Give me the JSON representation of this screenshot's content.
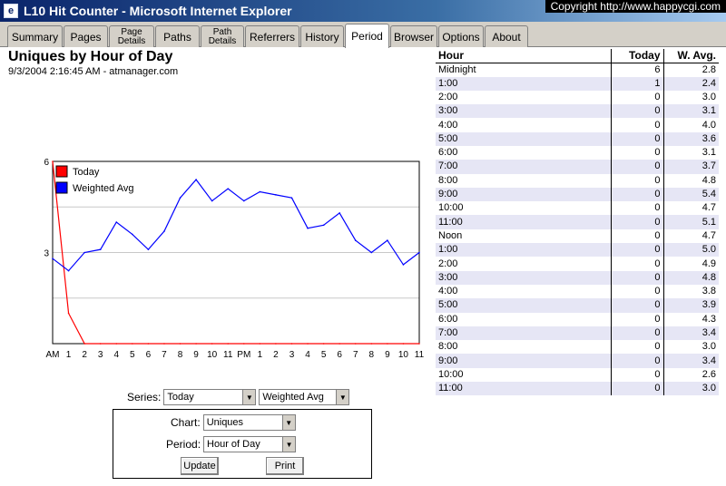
{
  "window": {
    "title": "L10 Hit Counter - Microsoft Internet Explorer",
    "copyright": "Copyright   http://www.happycgi.com"
  },
  "tabs": [
    {
      "label": "Summary"
    },
    {
      "label": "Pages"
    },
    {
      "label": "Page\nDetails"
    },
    {
      "label": "Paths"
    },
    {
      "label": "Path\nDetails"
    },
    {
      "label": "Referrers"
    },
    {
      "label": "History"
    },
    {
      "label": "Period",
      "active": true
    },
    {
      "label": "Browser"
    },
    {
      "label": "Options"
    },
    {
      "label": "About"
    }
  ],
  "heading": {
    "title": "Uniques by Hour of Day",
    "subtitle": "9/3/2004 2:16:45 AM - atmanager.com"
  },
  "chart_data": {
    "type": "line",
    "categories": [
      "AM",
      "1",
      "2",
      "3",
      "4",
      "5",
      "6",
      "7",
      "8",
      "9",
      "10",
      "11",
      "PM",
      "1",
      "2",
      "3",
      "4",
      "5",
      "6",
      "7",
      "8",
      "9",
      "10",
      "11"
    ],
    "series": [
      {
        "name": "Today",
        "color": "#ff0000",
        "values": [
          6,
          1,
          0,
          0,
          0,
          0,
          0,
          0,
          0,
          0,
          0,
          0,
          0,
          0,
          0,
          0,
          0,
          0,
          0,
          0,
          0,
          0,
          0,
          0
        ]
      },
      {
        "name": "Weighted Avg",
        "color": "#0000ff",
        "values": [
          2.8,
          2.4,
          3.0,
          3.1,
          4.0,
          3.6,
          3.1,
          3.7,
          4.8,
          5.4,
          4.7,
          5.1,
          4.7,
          5.0,
          4.9,
          4.8,
          3.8,
          3.9,
          4.3,
          3.4,
          3.0,
          3.4,
          2.6,
          3.0
        ]
      }
    ],
    "y_ticks": [
      "6",
      "3"
    ],
    "ylim": [
      0,
      6
    ],
    "legend": "top-left",
    "grid": true
  },
  "controls": {
    "series_label": "Series:",
    "series1": "Today",
    "series2": "Weighted Avg",
    "chart_label": "Chart:",
    "chart_value": "Uniques",
    "period_label": "Period:",
    "period_value": "Hour of Day",
    "update": "Update",
    "print": "Print"
  },
  "table": {
    "headers": {
      "hour": "Hour",
      "today": "Today",
      "avg": "W. Avg."
    },
    "rows": [
      {
        "hour": "Midnight",
        "today": "6",
        "avg": "2.8"
      },
      {
        "hour": "1:00",
        "today": "1",
        "avg": "2.4"
      },
      {
        "hour": "2:00",
        "today": "0",
        "avg": "3.0"
      },
      {
        "hour": "3:00",
        "today": "0",
        "avg": "3.1"
      },
      {
        "hour": "4:00",
        "today": "0",
        "avg": "4.0"
      },
      {
        "hour": "5:00",
        "today": "0",
        "avg": "3.6"
      },
      {
        "hour": "6:00",
        "today": "0",
        "avg": "3.1"
      },
      {
        "hour": "7:00",
        "today": "0",
        "avg": "3.7"
      },
      {
        "hour": "8:00",
        "today": "0",
        "avg": "4.8"
      },
      {
        "hour": "9:00",
        "today": "0",
        "avg": "5.4"
      },
      {
        "hour": "10:00",
        "today": "0",
        "avg": "4.7"
      },
      {
        "hour": "11:00",
        "today": "0",
        "avg": "5.1"
      },
      {
        "hour": "Noon",
        "today": "0",
        "avg": "4.7"
      },
      {
        "hour": "1:00",
        "today": "0",
        "avg": "5.0"
      },
      {
        "hour": "2:00",
        "today": "0",
        "avg": "4.9"
      },
      {
        "hour": "3:00",
        "today": "0",
        "avg": "4.8"
      },
      {
        "hour": "4:00",
        "today": "0",
        "avg": "3.8"
      },
      {
        "hour": "5:00",
        "today": "0",
        "avg": "3.9"
      },
      {
        "hour": "6:00",
        "today": "0",
        "avg": "4.3"
      },
      {
        "hour": "7:00",
        "today": "0",
        "avg": "3.4"
      },
      {
        "hour": "8:00",
        "today": "0",
        "avg": "3.0"
      },
      {
        "hour": "9:00",
        "today": "0",
        "avg": "3.4"
      },
      {
        "hour": "10:00",
        "today": "0",
        "avg": "2.6"
      },
      {
        "hour": "11:00",
        "today": "0",
        "avg": "3.0"
      }
    ]
  }
}
